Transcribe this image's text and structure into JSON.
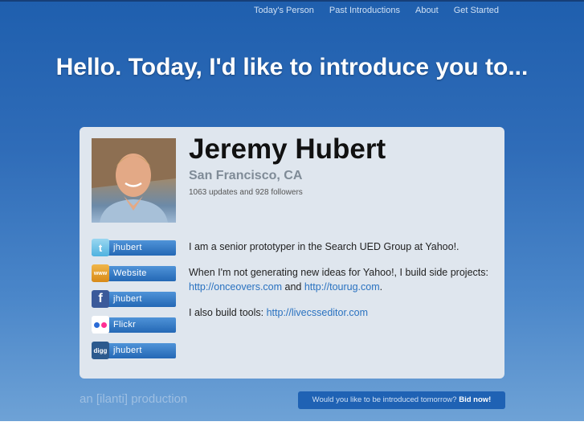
{
  "nav": {
    "items": [
      "Today's Person",
      "Past Introductions",
      "About",
      "Get Started"
    ]
  },
  "headline": "Hello. Today, I'd like to introduce you to...",
  "profile": {
    "name": "Jeremy Hubert",
    "location": "San Francisco, CA",
    "stats": "1063 updates and 928 followers"
  },
  "links": [
    {
      "label": "jhubert",
      "icon": "twitter-icon",
      "glyph": "t"
    },
    {
      "label": "Website",
      "icon": "website-icon",
      "glyph": "www"
    },
    {
      "label": "jhubert",
      "icon": "facebook-icon",
      "glyph": "f"
    },
    {
      "label": "Flickr",
      "icon": "flickr-icon",
      "glyph": ""
    },
    {
      "label": "jhubert",
      "icon": "digg-icon",
      "glyph": "digg"
    }
  ],
  "bio": {
    "p1": "I am a senior prototyper in the Search UED Group at Yahoo!.",
    "p2_text": "When I'm not generating new ideas for Yahoo!, I build side projects: ",
    "p2_link1": "http://onceovers.com",
    "p2_and": " and ",
    "p2_link2": "http://tourug.com",
    "p2_end": ".",
    "p3_text": "I also build tools: ",
    "p3_link": "http://livecsseditor.com"
  },
  "footer": {
    "brand": "an [ilanti] production",
    "cta_text": "Would you like to be introduced tomorrow? ",
    "cta_link": "Bid now!"
  },
  "colors": {
    "background": "#2f6cb8",
    "card": "#dfe6ee",
    "link": "#2a72c0",
    "button": "#2468b5"
  }
}
